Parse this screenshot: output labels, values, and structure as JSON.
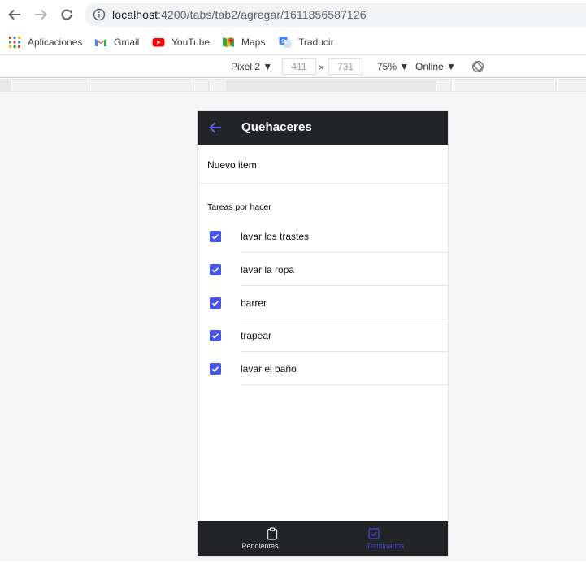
{
  "browser": {
    "url_host": "localhost",
    "url_path": ":4200/tabs/tab2/agregar/1611856587126",
    "bookmarks": [
      {
        "label": "Aplicaciones",
        "icon": "apps-grid-icon"
      },
      {
        "label": "Gmail",
        "icon": "gmail-icon"
      },
      {
        "label": "YouTube",
        "icon": "youtube-icon"
      },
      {
        "label": "Maps",
        "icon": "maps-icon"
      },
      {
        "label": "Traducir",
        "icon": "translate-icon"
      }
    ]
  },
  "devtools": {
    "device": "Pixel 2",
    "width": "411",
    "times": "×",
    "height": "731",
    "zoom": "75%",
    "network": "Online"
  },
  "app": {
    "title": "Quehaceres",
    "new_item": "Nuevo item",
    "list_header": "Tareas por hacer",
    "accent_color": "#4654e9",
    "header_color": "#222428",
    "todos": [
      {
        "label": "lavar los trastes",
        "checked": true
      },
      {
        "label": "lavar la ropa",
        "checked": true
      },
      {
        "label": "barrer",
        "checked": true
      },
      {
        "label": "trapear",
        "checked": true
      },
      {
        "label": "lavar el baño",
        "checked": true
      }
    ],
    "tabs": [
      {
        "label": "Pendientes",
        "icon": "clipboard-icon",
        "active": false
      },
      {
        "label": "Terminados",
        "icon": "checkbox-icon",
        "active": true
      }
    ]
  }
}
